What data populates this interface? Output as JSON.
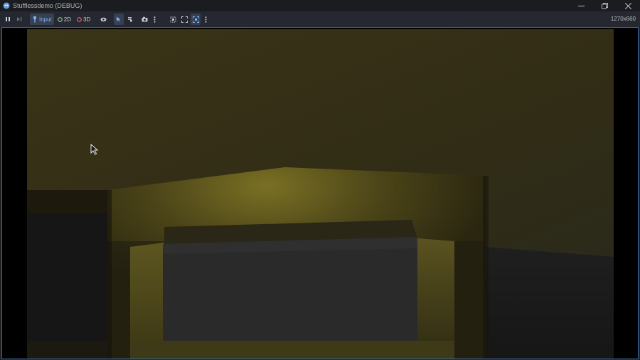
{
  "window": {
    "title": "Stufflessdemo (DEBUG)",
    "icon": "godot-icon",
    "controls": [
      "minimize-icon",
      "restore-icon",
      "close-icon"
    ]
  },
  "toolbar": {
    "pause_icon": "pause-icon",
    "next_frame_icon": "next-frame-icon",
    "input_label": "Input",
    "mode_2d_label": "2D",
    "mode_3d_label": "3D",
    "resolution": "1270x660"
  },
  "colors": {
    "accent_blue": "#3a6ea5",
    "mode_2d_dot": "#7fc88a",
    "mode_3d_dot": "#e0606a",
    "active_button_bg": "#36404f"
  }
}
